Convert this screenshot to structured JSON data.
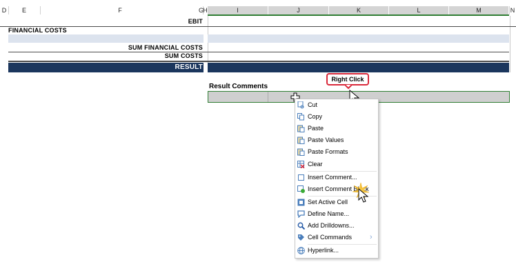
{
  "columns": [
    "D",
    "E",
    "F",
    "G",
    "H",
    "I",
    "J",
    "K",
    "L",
    "M",
    "N"
  ],
  "rows": {
    "ebit": "EBIT",
    "financial_costs": "FINANCIAL COSTS",
    "sum_financial_costs": "SUM FINANCIAL COSTS",
    "sum_costs": "SUM COSTS",
    "result": "RESULT"
  },
  "result_comments": "Result Comments",
  "callout": "Right Click",
  "context_menu": [
    {
      "label": "Cut",
      "icon": "cut-icon"
    },
    {
      "label": "Copy",
      "icon": "copy-icon"
    },
    {
      "label": "Paste",
      "icon": "paste-icon"
    },
    {
      "label": "Paste Values",
      "icon": "paste-values-icon"
    },
    {
      "label": "Paste Formats",
      "icon": "paste-formats-icon"
    },
    {
      "label": "Clear",
      "icon": "clear-icon"
    },
    {
      "label": "Insert Comment...",
      "icon": "insert-comment-icon"
    },
    {
      "label": "Insert Comment Block",
      "icon": "insert-comment-block-icon"
    },
    {
      "label": "Set Active Cell",
      "icon": "set-active-cell-icon"
    },
    {
      "label": "Define Name...",
      "icon": "define-name-icon"
    },
    {
      "label": "Add Drilldowns...",
      "icon": "add-drilldowns-icon"
    },
    {
      "label": "Cell Commands",
      "icon": "cell-commands-icon",
      "submenu": "›"
    },
    {
      "label": "Hyperlink...",
      "icon": "hyperlink-icon"
    }
  ],
  "colors": {
    "header_gray": "#d4d4d4",
    "band_blue": "#dce3ee",
    "result_navy": "#1b365d",
    "selection_green": "#2e7d32",
    "callout_red": "#d9283a"
  }
}
